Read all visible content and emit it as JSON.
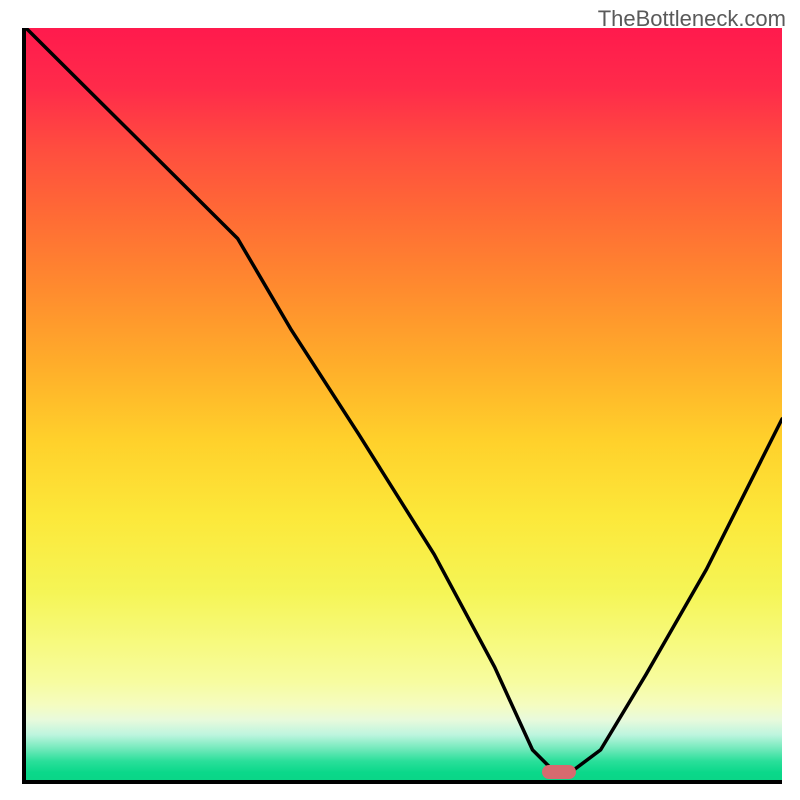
{
  "watermark": "TheBottleneck.com",
  "chart_data": {
    "type": "line",
    "title": "",
    "xlabel": "",
    "ylabel": "",
    "xlim": [
      0,
      100
    ],
    "ylim": [
      0,
      100
    ],
    "background_gradient_note": "vertical gradient red (top, high bottleneck) to green (bottom, low bottleneck)",
    "series": [
      {
        "name": "bottleneck-curve",
        "x": [
          0,
          10,
          20,
          28,
          35,
          44,
          54,
          62,
          67,
          70,
          72,
          76,
          82,
          90,
          100
        ],
        "values": [
          100,
          90,
          80,
          72,
          60,
          46,
          30,
          15,
          4,
          1,
          1,
          4,
          14,
          28,
          48
        ]
      }
    ],
    "marker": {
      "name": "optimal-point",
      "x_center": 70.5,
      "width_pct": 4.5,
      "height_pct": 1.9,
      "color": "#d66a6f"
    },
    "axes": {
      "left_border": true,
      "bottom_border": true,
      "ticks": false,
      "grid": false
    }
  }
}
